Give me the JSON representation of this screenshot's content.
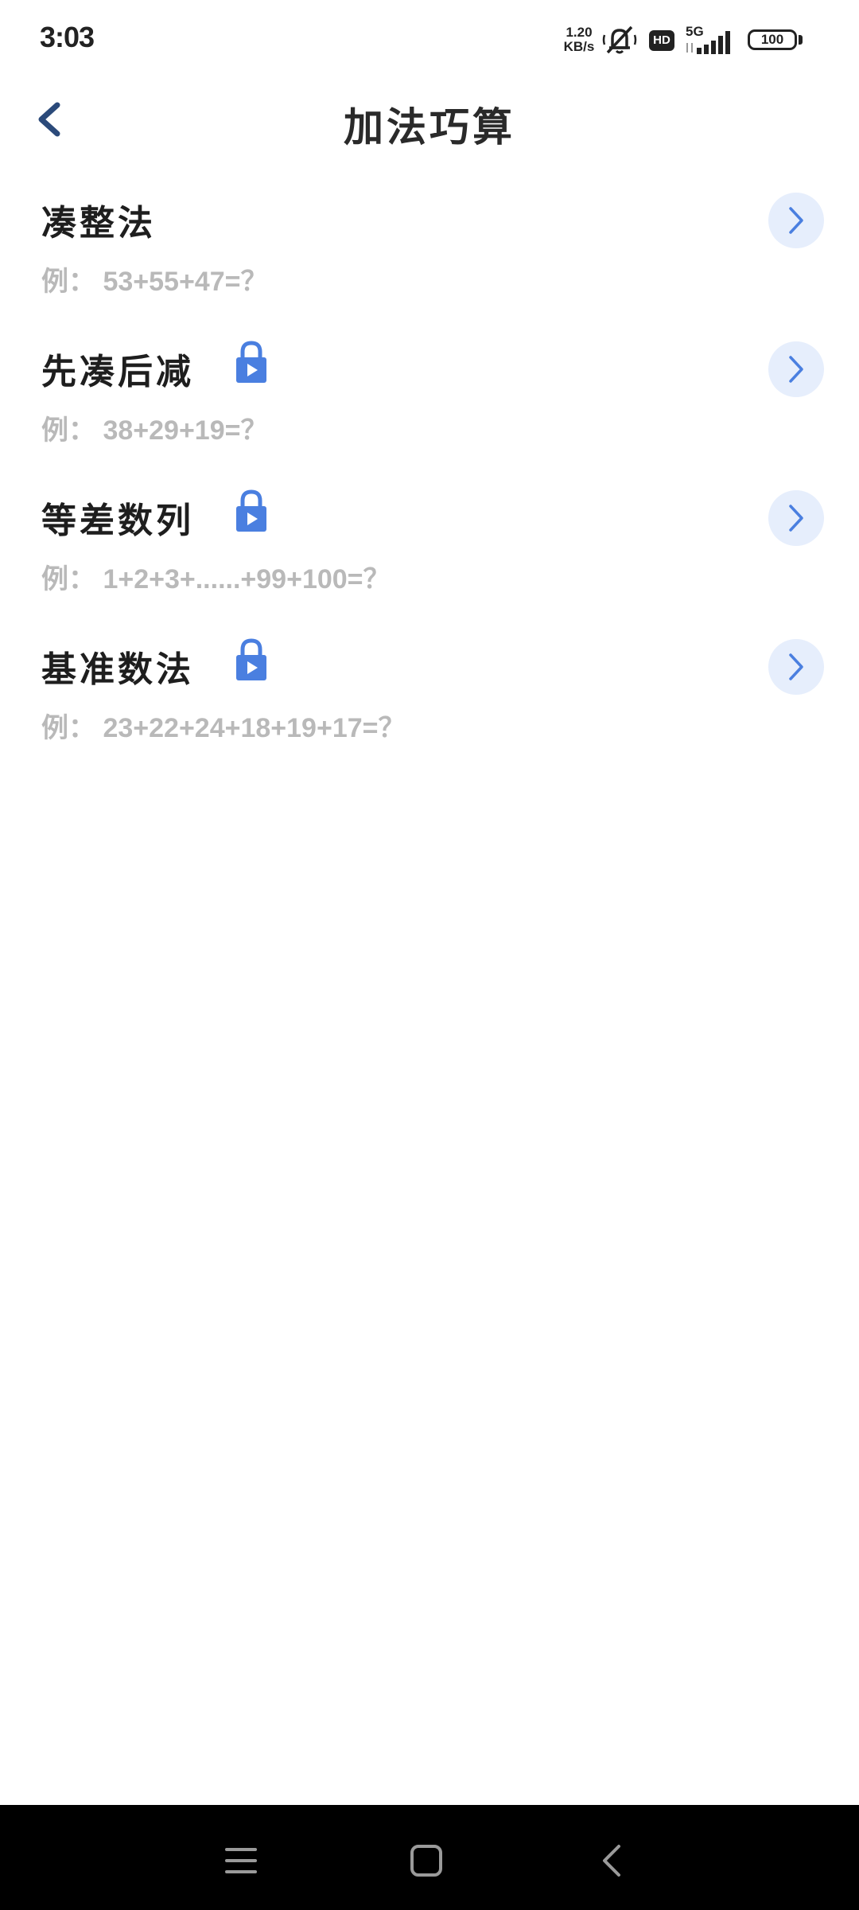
{
  "status_bar": {
    "time": "3:03",
    "net_speed_value": "1.20",
    "net_speed_unit": "KB/s",
    "hd": "HD",
    "network": "5G",
    "battery": "100",
    "icons": [
      "mute-bell-icon",
      "hd-icon",
      "signal-icon",
      "battery-icon"
    ]
  },
  "header": {
    "title": "加法巧算",
    "back_icon": "chevron-left-icon"
  },
  "items": [
    {
      "title": "凑整法",
      "example": "例：  53+55+47=？",
      "locked": false
    },
    {
      "title": "先凑后减",
      "example": "例：  38+29+19=？",
      "locked": true
    },
    {
      "title": "等差数列",
      "example": "例：  1+2+3+......+99+100=？",
      "locked": true
    },
    {
      "title": "基准数法",
      "example": "例：  23+22+24+18+19+17=？",
      "locked": true
    }
  ],
  "colors": {
    "accent": "#4a7fe0",
    "arrow_bg": "#e6eefc",
    "title_text": "#1e1e1e",
    "example_text": "#b9b9b9",
    "back_arrow": "#2b4a7a"
  },
  "nav_bar": {
    "icons": [
      "menu-icon",
      "home-icon",
      "back-icon"
    ]
  }
}
